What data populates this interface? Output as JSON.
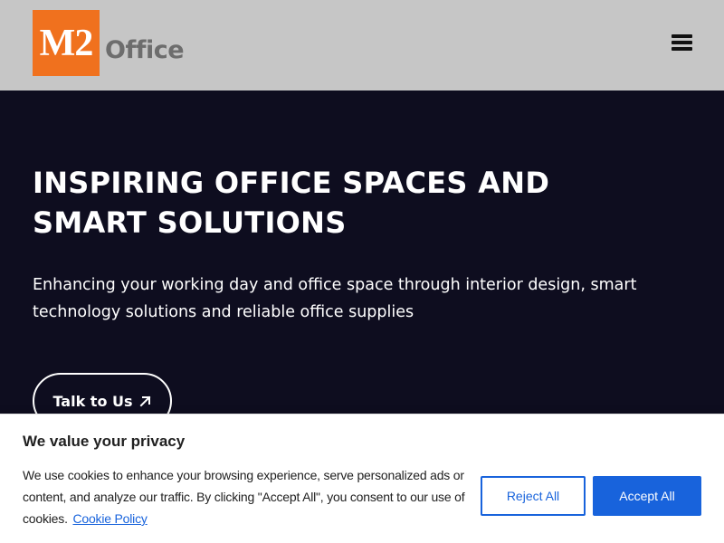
{
  "header": {
    "logo": {
      "mark": "M2",
      "text": "Office",
      "brand_color": "#f0711e"
    },
    "menu_icon": "hamburger-menu-icon"
  },
  "hero": {
    "title_line1": "INSPIRING OFFICE SPACES AND",
    "title_line2": "SMART SOLUTIONS",
    "subtitle": "Enhancing your working day and office space through interior design, smart technology solutions and reliable office supplies",
    "cta_label": "Talk to Us",
    "cta_icon": "arrow-up-right-icon",
    "background_color": "#0e0d1f"
  },
  "cookie_banner": {
    "title": "We value your privacy",
    "text": "We use cookies to enhance your browsing experience, serve personalized ads or content, and analyze our traffic. By clicking \"Accept All\", you consent to our use of cookies.",
    "policy_link": "Cookie Policy",
    "reject_label": "Reject All",
    "accept_label": "Accept All",
    "accent_color": "#1863dc"
  }
}
